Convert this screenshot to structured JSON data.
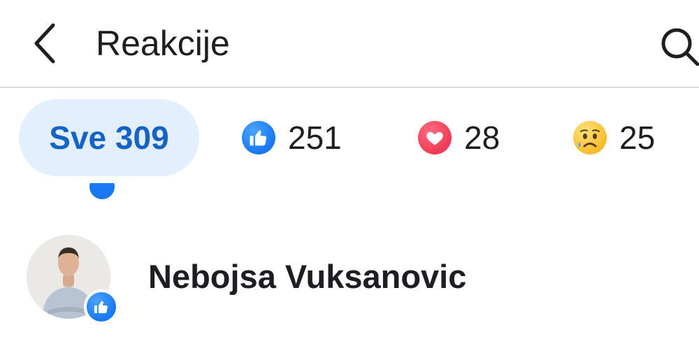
{
  "header": {
    "title": "Reakcije",
    "back_icon": "chevron-left-icon",
    "search_icon": "search-icon"
  },
  "tabs": [
    {
      "label": "Sve",
      "count": "309",
      "text": "Sve 309",
      "selected": true
    },
    {
      "icon": "like-icon",
      "count": "251"
    },
    {
      "icon": "love-icon",
      "count": "28"
    },
    {
      "icon": "sad-icon",
      "count": "25"
    }
  ],
  "people": [
    {
      "name": "Nebojsa Vuksanovic",
      "reaction": "like-icon"
    }
  ],
  "colors": {
    "accent": "#1877f2",
    "selected_tab_bg": "#e3effc",
    "selected_tab_text": "#1663c7",
    "love": "#ef3b54",
    "sad": "#f7b928",
    "divider": "#dcdcdc"
  }
}
